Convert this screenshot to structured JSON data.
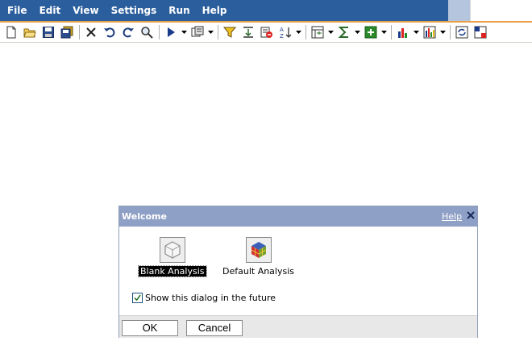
{
  "menu": {
    "items": [
      "File",
      "Edit",
      "View",
      "Settings",
      "Run",
      "Help"
    ]
  },
  "toolbar": {
    "buttons": [
      "new-document-icon",
      "open-folder-icon",
      "save-icon",
      "save-all-icon",
      "delete-icon",
      "undo-icon",
      "redo-icon",
      "find-icon",
      "run-icon",
      "run-options-icon",
      "filter-icon",
      "sort-icon",
      "suppress-icon",
      "sort-az-icon",
      "layout-icon",
      "sum-icon",
      "calculate-icon",
      "bar-chart-icon",
      "column-chart-icon",
      "refresh-icon",
      "pivot-icon"
    ]
  },
  "dialog": {
    "title": "Welcome",
    "help_label": "Help",
    "close_glyph": "✕",
    "choices": [
      {
        "label": "Blank Analysis",
        "icon": "blank-cube-icon",
        "selected": true
      },
      {
        "label": "Default Analysis",
        "icon": "colored-cube-icon",
        "selected": false
      }
    ],
    "checkbox": {
      "label": "Show this dialog in the future",
      "checked": true
    },
    "ok_label": "OK",
    "cancel_label": "Cancel"
  },
  "colors": {
    "menubar": "#2a5e9c",
    "accent_line": "#e8a14a",
    "dialog_title": "#8fa0c6"
  }
}
